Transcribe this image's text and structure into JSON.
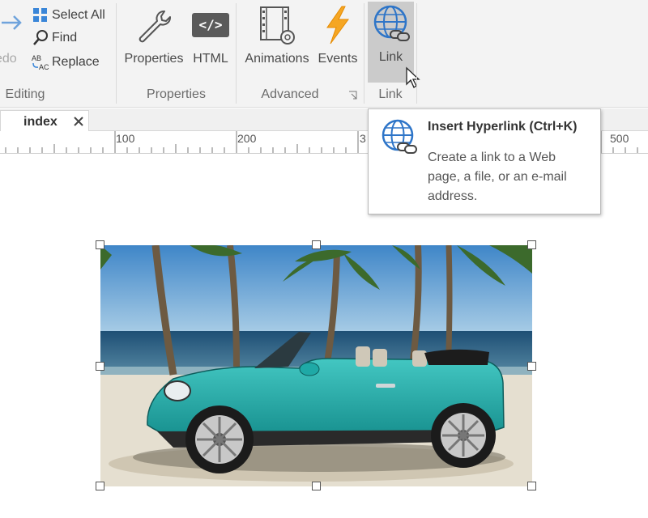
{
  "ribbon": {
    "editing": {
      "redo_label": "edo",
      "select_all_label": "Select All",
      "find_label": "Find",
      "replace_label": "Replace",
      "replace_icon_text": "AB AC",
      "group_label": "Editing"
    },
    "properties": {
      "properties_label": "Properties",
      "html_label": "HTML",
      "html_icon_text": "</>",
      "group_label": "Properties"
    },
    "advanced": {
      "animations_label": "Animations",
      "events_label": "Events",
      "group_label": "Advanced"
    },
    "link": {
      "link_label": "Link",
      "group_label": "Link"
    }
  },
  "tabs": [
    {
      "label": "index"
    }
  ],
  "ruler": {
    "labels": [
      "100",
      "200",
      "3",
      "500"
    ]
  },
  "tooltip": {
    "title": "Insert Hyperlink (Ctrl+K)",
    "description": "Create a link to a Web page, a file, or an e-mail address."
  },
  "colors": {
    "ribbon_bg": "#f3f3f3",
    "selected_button_bg": "#cbcbcb",
    "icon_blue": "#2e75c8",
    "events_orange": "#f5a623",
    "car_teal": "#1fa9a6"
  }
}
